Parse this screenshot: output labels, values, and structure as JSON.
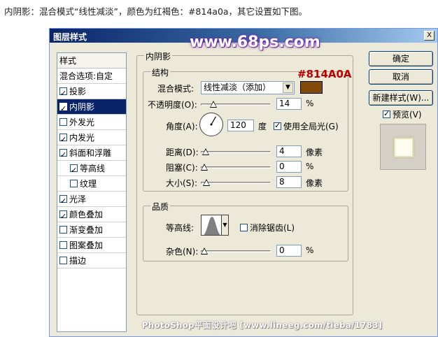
{
  "caption": "内阴影：混合模式“线性减淡”，颜色为红褐色：#814a0a，其它设置如下图。",
  "dialog": {
    "title": "图层样式",
    "close_label": "X",
    "watermark": "www.68ps.com",
    "footer_credit": "PhotoShop平面设计吧   [www.lineeg.com/tieba/1783]"
  },
  "styles_panel": {
    "header": "样式",
    "blend_options": "混合选项:自定",
    "items": [
      {
        "label": "投影",
        "checked": true,
        "sub": false,
        "selected": false
      },
      {
        "label": "内阴影",
        "checked": true,
        "sub": false,
        "selected": true
      },
      {
        "label": "外发光",
        "checked": false,
        "sub": false,
        "selected": false
      },
      {
        "label": "内发光",
        "checked": true,
        "sub": false,
        "selected": false
      },
      {
        "label": "斜面和浮雕",
        "checked": true,
        "sub": false,
        "selected": false
      },
      {
        "label": "等高线",
        "checked": true,
        "sub": true,
        "selected": false
      },
      {
        "label": "纹理",
        "checked": false,
        "sub": true,
        "selected": false
      },
      {
        "label": "光泽",
        "checked": true,
        "sub": false,
        "selected": false
      },
      {
        "label": "颜色叠加",
        "checked": true,
        "sub": false,
        "selected": false
      },
      {
        "label": "渐变叠加",
        "checked": false,
        "sub": false,
        "selected": false
      },
      {
        "label": "图案叠加",
        "checked": false,
        "sub": false,
        "selected": false
      },
      {
        "label": "描边",
        "checked": false,
        "sub": false,
        "selected": false
      }
    ]
  },
  "inner_shadow": {
    "section_title": "内阴影",
    "structure_title": "结构",
    "blend_mode_label": "混合模式:",
    "blend_mode_value": "线性减淡（添加）",
    "color": "#814A0A",
    "color_hex_label": "#814A0A",
    "opacity_label": "不透明度(O):",
    "opacity_value": "14",
    "opacity_unit": "%",
    "opacity_fraction": 0.14,
    "angle_label": "角度(A):",
    "angle_value": "120",
    "angle_unit": "度",
    "angle_degrees": 120,
    "global_light_label": "使用全局光(G)",
    "global_light_checked": true,
    "distance_label": "距离(D):",
    "distance_value": "4",
    "distance_unit": "像素",
    "distance_fraction": 0.02,
    "choke_label": "阻塞(C):",
    "choke_value": "0",
    "choke_unit": "%",
    "choke_fraction": 0,
    "size_label": "大小(S):",
    "size_value": "8",
    "size_unit": "像素",
    "size_fraction": 0.03,
    "quality_title": "品质",
    "contour_label": "等高线:",
    "anti_alias_label": "消除锯齿(L)",
    "anti_alias_checked": false,
    "noise_label": "杂色(N):",
    "noise_value": "0",
    "noise_unit": "%",
    "noise_fraction": 0
  },
  "buttons": {
    "ok": "确定",
    "cancel": "取消",
    "new_style": "新建样式(W)...",
    "preview_label": "预览(V)",
    "preview_checked": true
  }
}
